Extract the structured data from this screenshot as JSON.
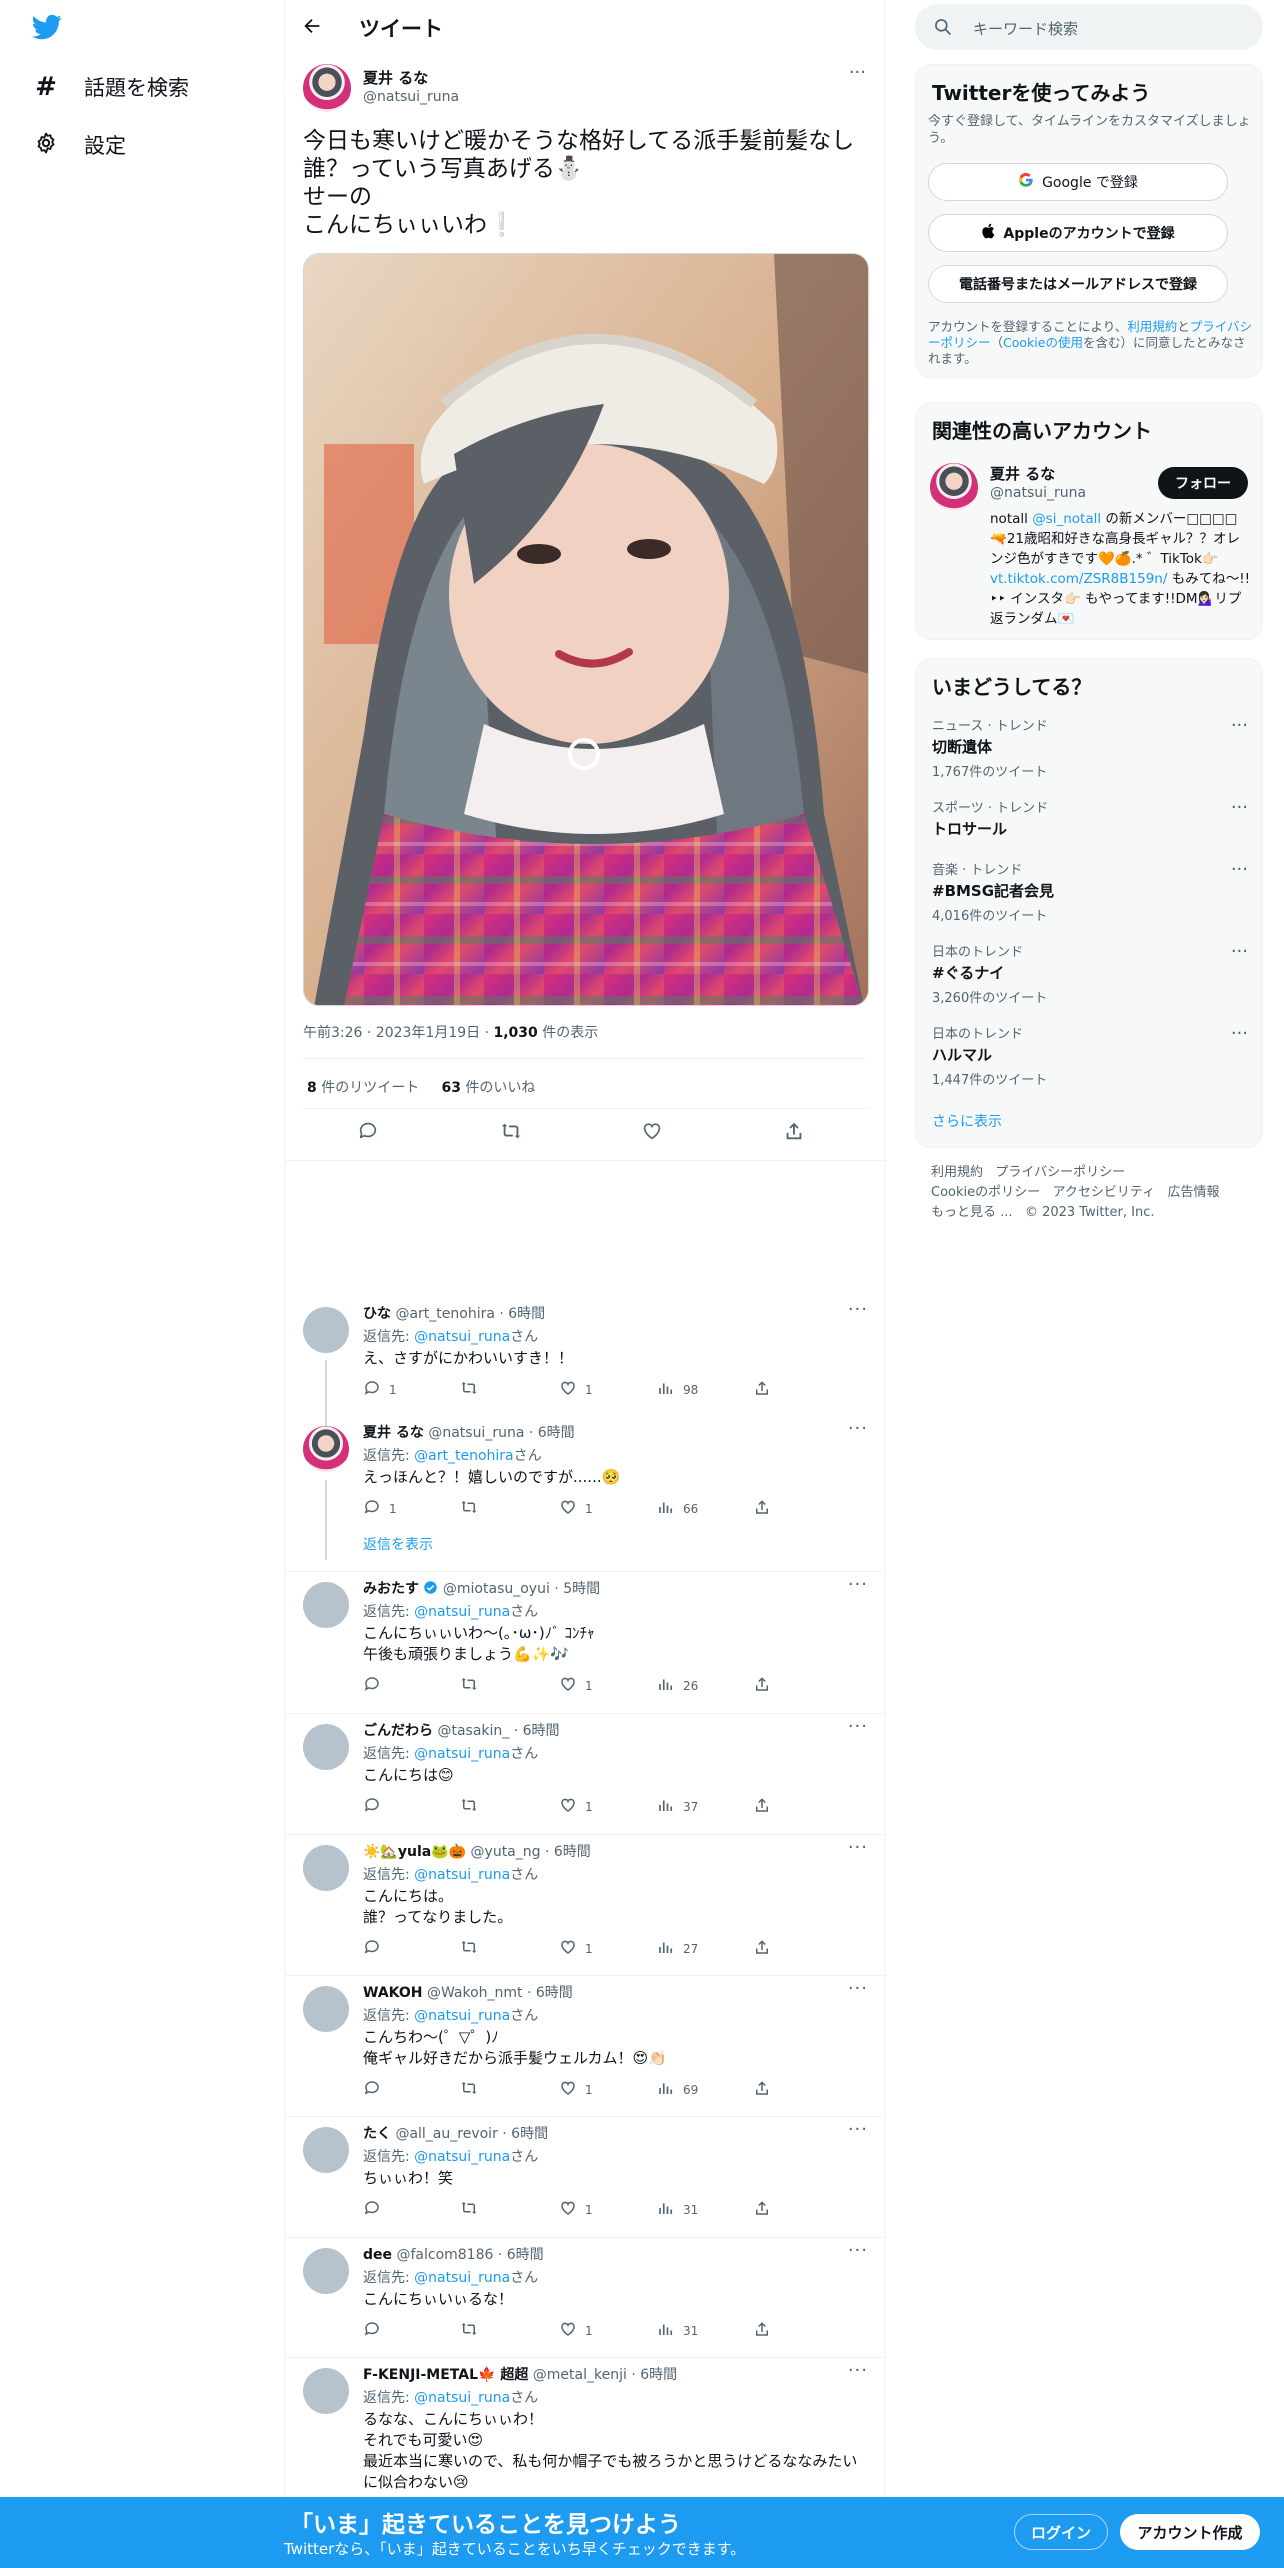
{
  "nav": {
    "explore": "話題を検索",
    "settings": "設定"
  },
  "header": {
    "title": "ツイート"
  },
  "post": {
    "display_name": "夏井 るな",
    "handle": "@natsui_runa",
    "more": "···",
    "lines": [
      "今日も寒いけど暖かそうな格好してる派手髪前髪なし",
      "誰？っていう写真あげる⛄",
      "せーの",
      "こんにちぃぃいわ❕"
    ],
    "time": "午前3:26 · 2023年1月19日 · ",
    "views": "1,030",
    "views_label": " 件の表示",
    "retweets": "8",
    "retweets_label": " 件のリツイート",
    "likes": "63",
    "likes_label": " 件のいいね"
  },
  "replies": [
    {
      "name": "ひな",
      "handle": "@art_tenohira · 6時間",
      "to_label": "返信先: ",
      "to": "@natsui_runa",
      "to_suffix": "さん",
      "lines": [
        "え、さすがにかわいいすき！！"
      ],
      "reply": "1",
      "like": "1",
      "views": "98",
      "avatar": "grey"
    },
    {
      "name": "夏井 るな",
      "handle": "@natsui_runa · 6時間",
      "to_label": "返信先: ",
      "to": "@art_tenohira",
      "to_suffix": "さん",
      "lines": [
        "えっほんと？！嬉しいのですが......🥺"
      ],
      "reply": "1",
      "like": "1",
      "views": "66",
      "avatar": "girl",
      "show_replies": "返信を表示"
    },
    {
      "name": "みおたす",
      "handle": "@miotasu_oyui · 5時間",
      "to_label": "返信先: ",
      "to": "@natsui_runa",
      "to_suffix": "さん",
      "lines": [
        "こんにちぃぃいわ〜(｡･ω･)ﾉﾞ ｺﾝﾁｬ",
        "午後も頑張りましょう💪✨🎶"
      ],
      "reply": "",
      "like": "1",
      "views": "26",
      "avatar": "grey",
      "verified": true
    },
    {
      "name": "ごんだわら",
      "handle": "@tasakin_ · 6時間",
      "to_label": "返信先: ",
      "to": "@natsui_runa",
      "to_suffix": "さん",
      "lines": [
        "こんにちは😊"
      ],
      "reply": "",
      "like": "1",
      "views": "37",
      "avatar": "grey"
    },
    {
      "name": "☀️🏡yula🐸🎃",
      "handle": "@yuta_ng · 6時間",
      "to_label": "返信先: ",
      "to": "@natsui_runa",
      "to_suffix": "さん",
      "lines": [
        "こんにちは。",
        "誰？ってなりました。"
      ],
      "reply": "",
      "like": "1",
      "views": "27",
      "avatar": "grey"
    },
    {
      "name": "WAKOH",
      "handle": "@Wakoh_nmt · 6時間",
      "to_label": "返信先: ",
      "to": "@natsui_runa",
      "to_suffix": "さん",
      "lines": [
        "こんちわ〜(゜▽゜)ﾉ",
        "俺ギャル好きだから派手髪ウェルカム！😍👏🏻"
      ],
      "reply": "",
      "like": "1",
      "views": "69",
      "avatar": "grey"
    },
    {
      "name": "たく",
      "handle": "@all_au_revoir · 6時間",
      "to_label": "返信先: ",
      "to": "@natsui_runa",
      "to_suffix": "さん",
      "lines": [
        "ちぃぃわ！笑"
      ],
      "reply": "",
      "like": "1",
      "views": "31",
      "avatar": "grey"
    },
    {
      "name": "dee",
      "handle": "@falcom8186 · 6時間",
      "to_label": "返信先: ",
      "to": "@natsui_runa",
      "to_suffix": "さん",
      "lines": [
        "こんにちぃいぃるな！"
      ],
      "reply": "",
      "like": "1",
      "views": "31",
      "avatar": "grey"
    },
    {
      "name": "F-KENJI-METAL🍁 超超",
      "handle": "@metal_kenji · 6時間",
      "to_label": "返信先: ",
      "to": "@natsui_runa",
      "to_suffix": "さん",
      "lines": [
        "るなな、こんにちぃぃわ！",
        "それでも可愛い😍",
        "最近本当に寒いので、私も何か帽子でも被ろうかと思うけどるななみたい",
        "に似合わない😢"
      ],
      "reply": "",
      "like": "",
      "views": "",
      "avatar": "grey"
    }
  ],
  "sidebar": {
    "search_placeholder": "キーワード検索",
    "signup_card": {
      "title": "Twitterを使ってみよう",
      "subtitle": "今すぐ登録して、タイムラインをカスタマイズしましょう。",
      "google": "Google で登録",
      "apple": "Appleのアカウントで登録",
      "phone": "電話番号またはメールアドレスで登録",
      "terms_1": "アカウントを登録することにより、",
      "terms_link1": "利用規約",
      "terms_2": "と",
      "terms_link2": "プライバシーポリシー",
      "terms_3": "（",
      "terms_link3": "Cookieの使用",
      "terms_4": "を含む）に同意したとみなされます。"
    },
    "related": {
      "title": "関連性の高いアカウント",
      "name": "夏井 るな",
      "handle": "@natsui_runa",
      "follow": "フォロー",
      "bio_1": "notall ",
      "bio_link1": "@si_notall",
      "bio_2": " の新メンバー□□□□🔫",
      "bio_3": "21歳昭和好きな高身長ギャル？？オレンジ色がすきです🧡🍊.* ゛TikTok👉🏻",
      "bio_link2": "vt.tiktok.com/ZSR8B159n/",
      "bio_4": " もみてね〜!!‣‣ インスタ👉🏻 もやってます!!DM💁🏻‍♀️リプ返ランダム💌"
    },
    "trends": {
      "title": "いまどうしてる？",
      "items": [
        {
          "category": "ニュース · トレンド",
          "name": "切断遺体",
          "count": "1,767件のツイート"
        },
        {
          "category": "スポーツ · トレンド",
          "name": "トロサール",
          "count": ""
        },
        {
          "category": "音楽 · トレンド",
          "name": "#BMSG記者会見",
          "count": "4,016件のツイート"
        },
        {
          "category": "日本のトレンド",
          "name": "#ぐるナイ",
          "count": "3,260件のツイート"
        },
        {
          "category": "日本のトレンド",
          "name": "ハルマル",
          "count": "1,447件のツイート"
        }
      ],
      "more": "さらに表示"
    },
    "footer": {
      "terms": "利用規約",
      "privacy": "プライバシーポリシー",
      "cookie": "Cookieのポリシー",
      "access": "アクセシビリティ",
      "ads": "広告情報",
      "more": "もっと見る ...",
      "copyright": "© 2023 Twitter, Inc."
    }
  },
  "banner": {
    "title": "「いま」起きていることを見つけよう",
    "subtitle": "Twitterなら、「いま」起きていることをいち早くチェックできます。",
    "login": "ログイン",
    "signup": "アカウント作成"
  },
  "colors": {
    "accent": "#1d9bf0",
    "text": "#0f1419",
    "muted": "#536471"
  }
}
